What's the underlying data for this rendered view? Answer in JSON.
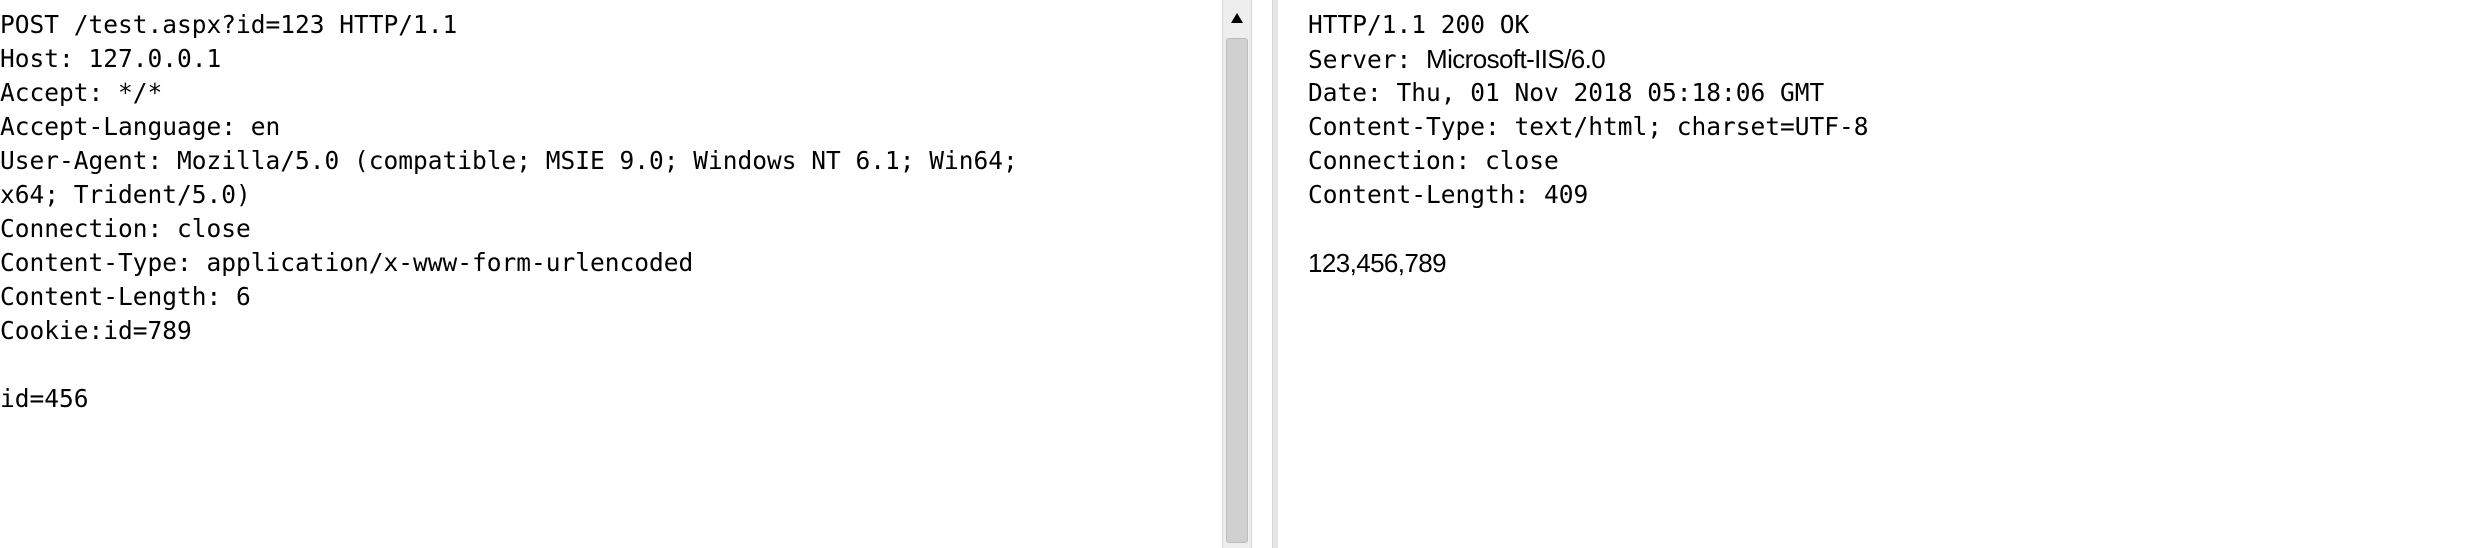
{
  "request": {
    "lines": [
      "POST /test.aspx?id=123 HTTP/1.1",
      "Host: 127.0.0.1",
      "Accept: */*",
      "Accept-Language: en",
      "User-Agent: Mozilla/5.0 (compatible; MSIE 9.0; Windows NT 6.1; Win64;",
      "x64; Trident/5.0)",
      "Connection: close",
      "Content-Type: application/x-www-form-urlencoded",
      "Content-Length: 6",
      "Cookie:id=789",
      "",
      "id=456"
    ]
  },
  "response": {
    "status_line": "HTTP/1.1 200 OK",
    "server_label": "Server: ",
    "server_value": "Microsoft-IIS/6.0",
    "date": "Date: Thu, 01 Nov 2018 05:18:06 GMT",
    "content_type": "Content-Type: text/html; charset=UTF-8",
    "connection": "Connection: close",
    "content_length": "Content-Length: 409",
    "body": "123,456,789"
  },
  "icons": {
    "scroll_up": "triangle-up-icon"
  },
  "colors": {
    "text": "#000000",
    "background": "#ffffff",
    "scrollbar_track": "#eeeeee",
    "scrollbar_thumb": "#d0d0d0"
  }
}
